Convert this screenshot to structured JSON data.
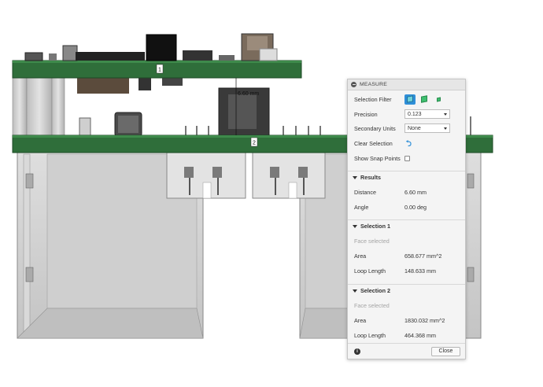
{
  "viewport": {
    "board_labels": [
      "1",
      "2"
    ],
    "dimension_label": "6.60 mm"
  },
  "measure": {
    "title": "MEASURE",
    "selection_filter_label": "Selection Filter",
    "filter_icons": [
      "body-select-icon",
      "face-select-icon",
      "edge-select-icon"
    ],
    "precision_label": "Precision",
    "precision_value": "0.123",
    "secondary_units_label": "Secondary Units",
    "secondary_units_value": "None",
    "clear_selection_label": "Clear Selection",
    "show_snap_points_label": "Show Snap Points",
    "show_snap_points_checked": false,
    "results": {
      "header": "Results",
      "distance_label": "Distance",
      "distance_value": "6.60 mm",
      "angle_label": "Angle",
      "angle_value": "0.00 deg"
    },
    "selection1": {
      "header": "Selection 1",
      "type": "Face selected",
      "area_label": "Area",
      "area_value": "658.677 mm^2",
      "loop_label": "Loop Length",
      "loop_value": "148.633 mm"
    },
    "selection2": {
      "header": "Selection 2",
      "type": "Face selected",
      "area_label": "Area",
      "area_value": "1830.032 mm^2",
      "loop_label": "Loop Length",
      "loop_value": "464.368 mm"
    },
    "close_label": "Close",
    "colors": {
      "active_filter": "#2f8fd8",
      "pcb_green": "#2f6e3a",
      "enclosure_grey": "#d2d2d2"
    }
  }
}
